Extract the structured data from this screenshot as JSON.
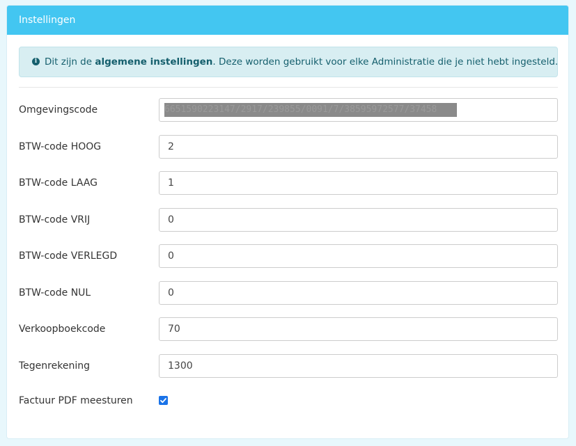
{
  "panel": {
    "title": "Instellingen"
  },
  "alert": {
    "icon": "info-circle-icon",
    "prefix": "Dit zijn de ",
    "bold": "algemene instellingen",
    "suffix": ". Deze worden gebruikt voor elke Administratie die je niet hebt ingesteld."
  },
  "fields": {
    "omgevingscode": {
      "label": "Omgevingscode",
      "value": "6651590223147/2917/239855/0091/7/38595972577/37458"
    },
    "btw_hoog": {
      "label": "BTW-code HOOG",
      "value": "2"
    },
    "btw_laag": {
      "label": "BTW-code LAAG",
      "value": "1"
    },
    "btw_vrij": {
      "label": "BTW-code VRIJ",
      "value": "0"
    },
    "btw_verlegd": {
      "label": "BTW-code VERLEGD",
      "value": "0"
    },
    "btw_nul": {
      "label": "BTW-code NUL",
      "value": "0"
    },
    "verkoopboekcode": {
      "label": "Verkoopboekcode",
      "value": "70"
    },
    "tegenrekening": {
      "label": "Tegenrekening",
      "value": "1300"
    },
    "factuur_pdf": {
      "label": "Factuur PDF meesturen",
      "checked": true
    }
  },
  "colors": {
    "header": "#43c6f1",
    "alert_bg": "#d8eef2",
    "alert_text": "#155f6d",
    "checkbox": "#1a73e8"
  }
}
